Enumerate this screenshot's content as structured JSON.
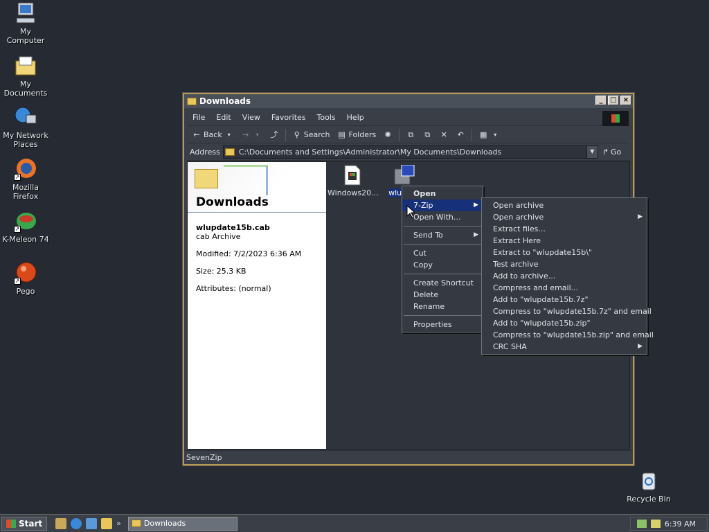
{
  "desktop": {
    "icons": [
      {
        "label": "My Computer"
      },
      {
        "label": "My Documents"
      },
      {
        "label": "My Network Places"
      },
      {
        "label": "Mozilla Firefox"
      },
      {
        "label": "K-Meleon 74"
      },
      {
        "label": "Pego"
      },
      {
        "label": "Recycle Bin"
      }
    ]
  },
  "window": {
    "title": "Downloads",
    "menu": [
      "File",
      "Edit",
      "View",
      "Favorites",
      "Tools",
      "Help"
    ],
    "toolbar": {
      "back": "Back",
      "search": "Search",
      "folders": "Folders"
    },
    "address": {
      "label": "Address",
      "value": "C:\\Documents and Settings\\Administrator\\My Documents\\Downloads",
      "go": "Go"
    },
    "left_pane": {
      "title": "Downloads",
      "file_name": "wlupdate15b.cab",
      "file_type": "cab Archive",
      "modified": "Modified: 7/2/2023 6:36 AM",
      "size": "Size: 25.3 KB",
      "attributes": "Attributes: (normal)"
    },
    "files": [
      {
        "label": "Windows20..."
      },
      {
        "label": "wlupda"
      }
    ],
    "status": "SevenZip"
  },
  "context_menu": {
    "items": [
      "Open",
      "7-Zip",
      "Open With...",
      "Send To",
      "Cut",
      "Copy",
      "Create Shortcut",
      "Delete",
      "Rename",
      "Properties"
    ]
  },
  "submenu_7zip": {
    "items": [
      "Open archive",
      "Open archive",
      "Extract files...",
      "Extract Here",
      "Extract to \"wlupdate15b\\\"",
      "Test archive",
      "Add to archive...",
      "Compress and email...",
      "Add to \"wlupdate15b.7z\"",
      "Compress to \"wlupdate15b.7z\" and email",
      "Add to \"wlupdate15b.zip\"",
      "Compress to \"wlupdate15b.zip\" and email",
      "CRC SHA"
    ]
  },
  "taskbar": {
    "start": "Start",
    "task": "Downloads",
    "clock": "6:39 AM"
  },
  "colors": {
    "selection": "#17307a",
    "window_border": "#b99b55",
    "desktop": "#262b33"
  }
}
